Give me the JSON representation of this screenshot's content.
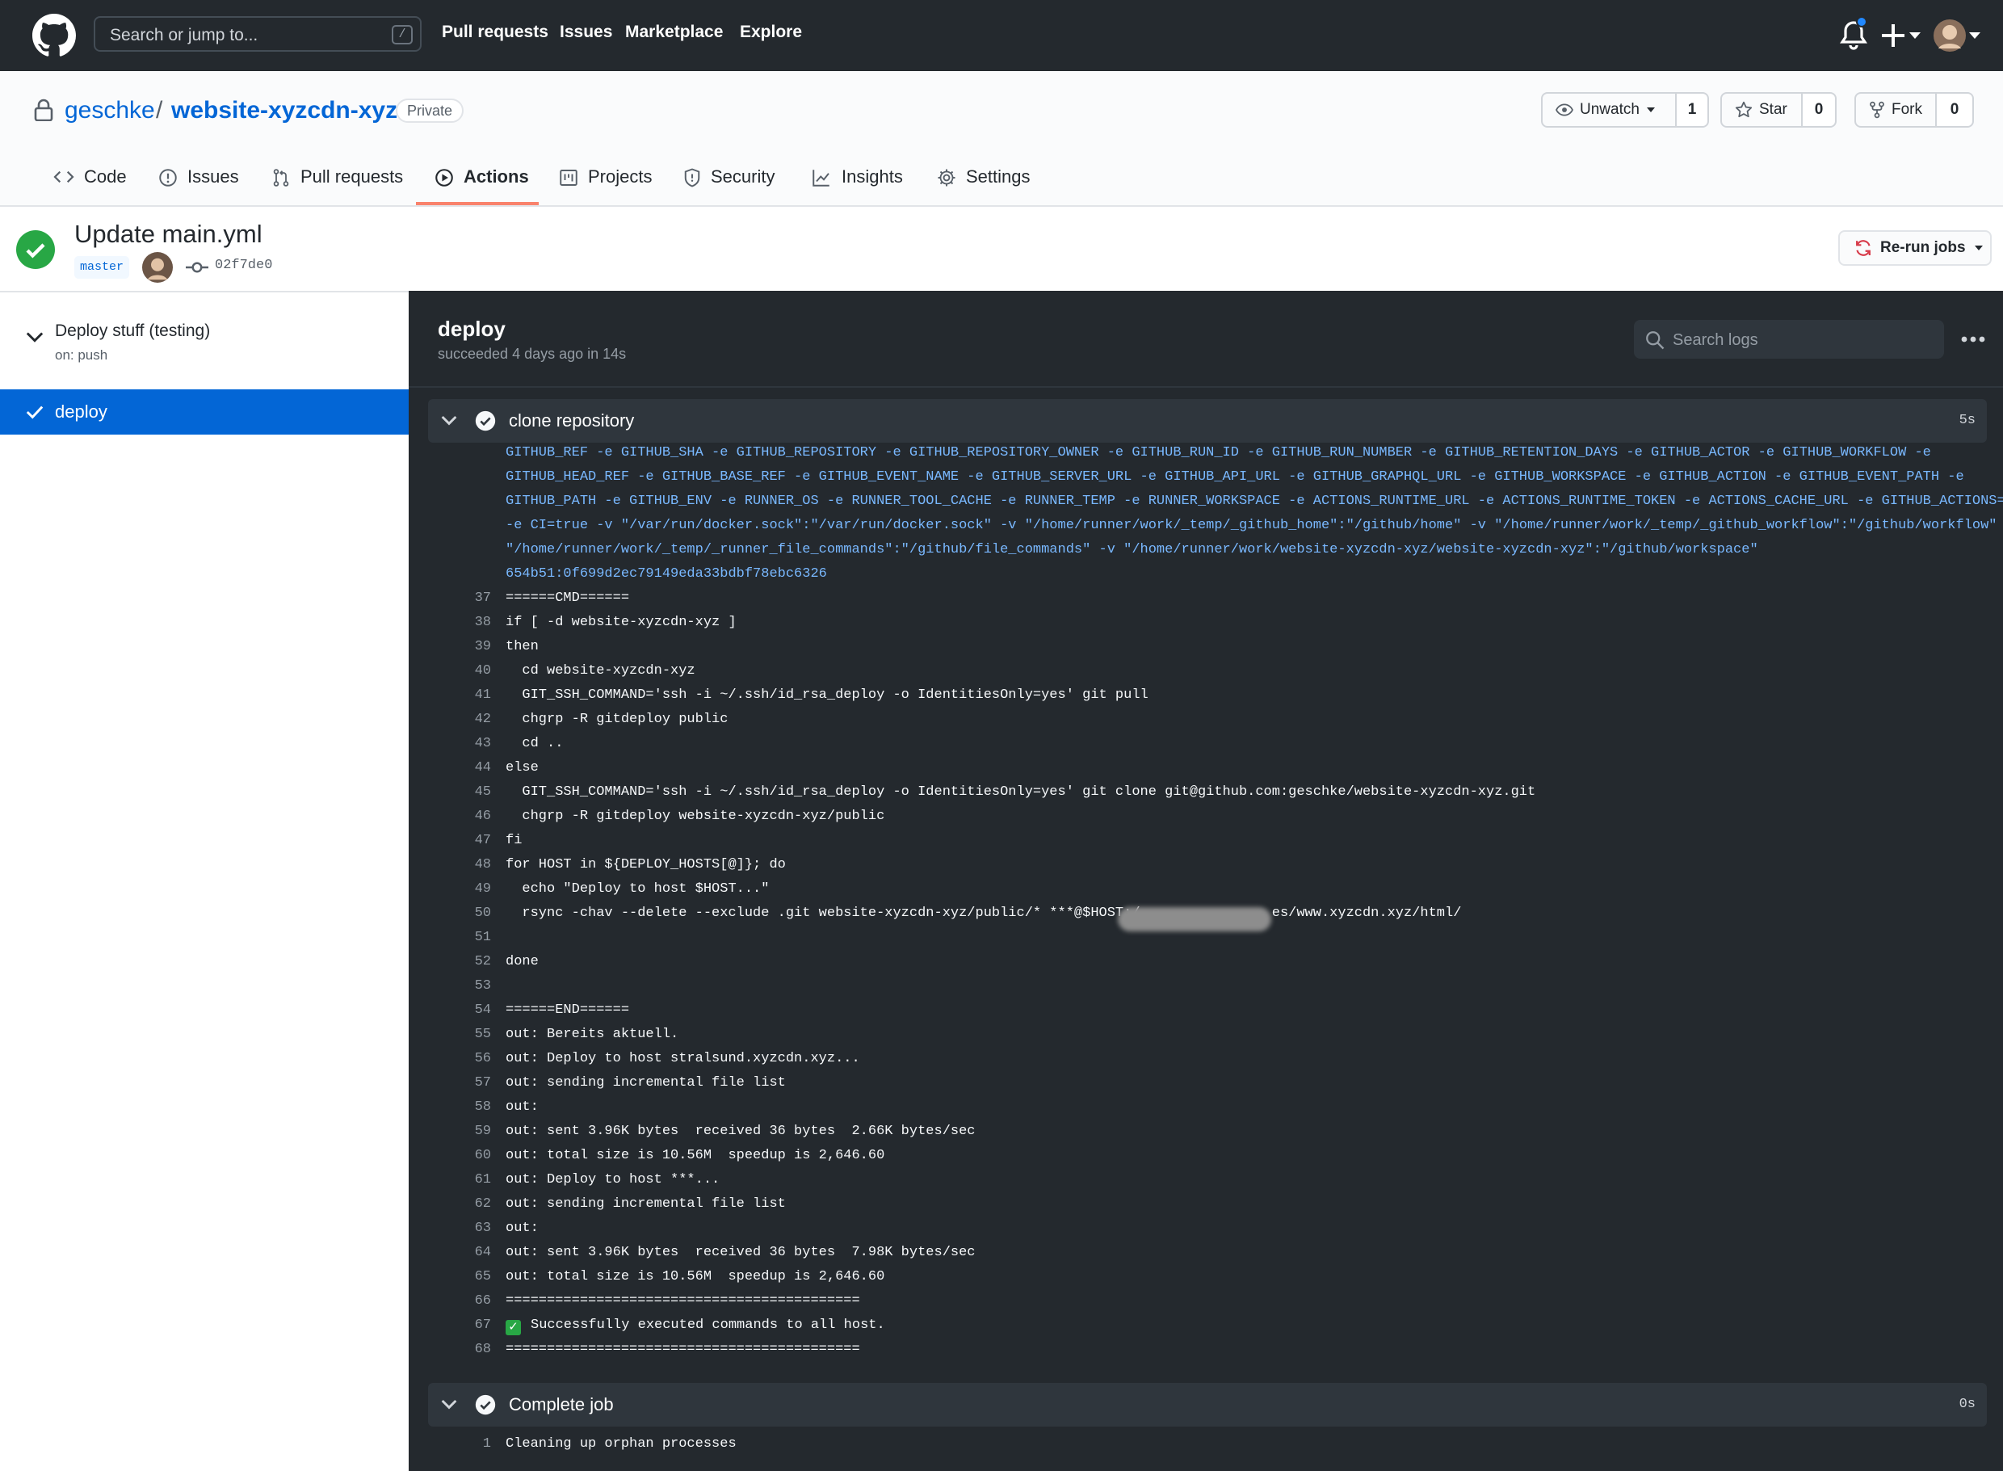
{
  "header": {
    "search_placeholder": "Search or jump to...",
    "search_shortcut": "/",
    "nav": [
      "Pull requests",
      "Issues",
      "Marketplace",
      "Explore"
    ]
  },
  "repo": {
    "owner": "geschke",
    "separator": "/",
    "name": "website-xyzcdn-xyz",
    "visibility": "Private",
    "watch_label": "Unwatch",
    "watch_count": "1",
    "star_label": "Star",
    "star_count": "0",
    "fork_label": "Fork",
    "fork_count": "0",
    "tabs": [
      "Code",
      "Issues",
      "Pull requests",
      "Actions",
      "Projects",
      "Security",
      "Insights",
      "Settings"
    ],
    "active_tab": "Actions"
  },
  "run": {
    "title": "Update main.yml",
    "branch": "master",
    "commit": "02f7de0",
    "rerun_label": "Re-run jobs"
  },
  "sidebar": {
    "workflow_name": "Deploy stuff (testing)",
    "trigger": "on: push",
    "jobs": [
      "deploy"
    ]
  },
  "log": {
    "job_title": "deploy",
    "job_status": "succeeded 4 days ago in 14s",
    "search_placeholder": "Search logs",
    "steps": [
      {
        "name": "clone repository",
        "duration": "5s"
      },
      {
        "name": "Complete job",
        "duration": "0s"
      }
    ],
    "wrapped_lines": [
      "GITHUB_REF -e GITHUB_SHA -e GITHUB_REPOSITORY -e GITHUB_REPOSITORY_OWNER -e GITHUB_RUN_ID -e GITHUB_RUN_NUMBER -e GITHUB_RETENTION_DAYS -e GITHUB_ACTOR -e GITHUB_WORKFLOW -e",
      "GITHUB_HEAD_REF -e GITHUB_BASE_REF -e GITHUB_EVENT_NAME -e GITHUB_SERVER_URL -e GITHUB_API_URL -e GITHUB_GRAPHQL_URL -e GITHUB_WORKSPACE -e GITHUB_ACTION -e GITHUB_EVENT_PATH -e",
      "GITHUB_PATH -e GITHUB_ENV -e RUNNER_OS -e RUNNER_TOOL_CACHE -e RUNNER_TEMP -e RUNNER_WORKSPACE -e ACTIONS_RUNTIME_URL -e ACTIONS_RUNTIME_TOKEN -e ACTIONS_CACHE_URL -e GITHUB_ACTIONS=true",
      "-e CI=true -v \"/var/run/docker.sock\":\"/var/run/docker.sock\" -v \"/home/runner/work/_temp/_github_home\":\"/github/home\" -v \"/home/runner/work/_temp/_github_workflow\":\"/github/workflow\" -v",
      "\"/home/runner/work/_temp/_runner_file_commands\":\"/github/file_commands\" -v \"/home/runner/work/website-xyzcdn-xyz/website-xyzcdn-xyz\":\"/github/workspace\"",
      "654b51:0f699d2ec79149eda33bdbf78ebc6326"
    ],
    "lines": [
      {
        "n": "37",
        "t": "======CMD======"
      },
      {
        "n": "38",
        "t": "if [ -d website-xyzcdn-xyz ]"
      },
      {
        "n": "39",
        "t": "then"
      },
      {
        "n": "40",
        "t": "  cd website-xyzcdn-xyz"
      },
      {
        "n": "41",
        "t": "  GIT_SSH_COMMAND='ssh -i ~/.ssh/id_rsa_deploy -o IdentitiesOnly=yes' git pull"
      },
      {
        "n": "42",
        "t": "  chgrp -R gitdeploy public"
      },
      {
        "n": "43",
        "t": "  cd .."
      },
      {
        "n": "44",
        "t": "else"
      },
      {
        "n": "45",
        "t": "  GIT_SSH_COMMAND='ssh -i ~/.ssh/id_rsa_deploy -o IdentitiesOnly=yes' git clone git@github.com:geschke/website-xyzcdn-xyz.git"
      },
      {
        "n": "46",
        "t": "  chgrp -R gitdeploy website-xyzcdn-xyz/public"
      },
      {
        "n": "47",
        "t": "fi"
      },
      {
        "n": "48",
        "t": "for HOST in ${DEPLOY_HOSTS[@]}; do"
      },
      {
        "n": "49",
        "t": "  echo \"Deploy to host $HOST...\""
      },
      {
        "n": "50",
        "t": "  rsync -chav --delete --exclude .git website-xyzcdn-xyz/public/* ***@$HOST:/                es/www.xyzcdn.xyz/html/"
      },
      {
        "n": "51",
        "t": ""
      },
      {
        "n": "52",
        "t": "done"
      },
      {
        "n": "53",
        "t": ""
      },
      {
        "n": "54",
        "t": "======END======"
      },
      {
        "n": "55",
        "t": "out: Bereits aktuell."
      },
      {
        "n": "56",
        "t": "out: Deploy to host stralsund.xyzcdn.xyz..."
      },
      {
        "n": "57",
        "t": "out: sending incremental file list"
      },
      {
        "n": "58",
        "t": "out:"
      },
      {
        "n": "59",
        "t": "out: sent 3.96K bytes  received 36 bytes  2.66K bytes/sec"
      },
      {
        "n": "60",
        "t": "out: total size is 10.56M  speedup is 2,646.60"
      },
      {
        "n": "61",
        "t": "out: Deploy to host ***..."
      },
      {
        "n": "62",
        "t": "out: sending incremental file list"
      },
      {
        "n": "63",
        "t": "out:"
      },
      {
        "n": "64",
        "t": "out: sent 3.96K bytes  received 36 bytes  7.98K bytes/sec"
      },
      {
        "n": "65",
        "t": "out: total size is 10.56M  speedup is 2,646.60"
      },
      {
        "n": "66",
        "t": "==========================================="
      },
      {
        "n": "67",
        "t": "Successfully executed commands to all host."
      },
      {
        "n": "68",
        "t": "==========================================="
      }
    ],
    "complete_lines": [
      {
        "n": "1",
        "t": "Cleaning up orphan processes"
      }
    ]
  },
  "colors": {
    "header_bg": "#24292e",
    "link": "#0366d6",
    "success": "#28a745",
    "active_tab_underline": "#f9826c",
    "log_bg": "#24292e",
    "log_env_text": "#79b8ff"
  },
  "icons": [
    "github-logo-icon",
    "lock-icon",
    "eye-icon",
    "star-icon",
    "fork-icon",
    "code-icon",
    "issue-icon",
    "pull-request-icon",
    "play-icon",
    "project-icon",
    "shield-icon",
    "graph-icon",
    "gear-icon",
    "bell-icon",
    "plus-icon",
    "check-icon",
    "commit-icon",
    "sync-icon",
    "search-icon",
    "kebab-icon",
    "chevron-down-icon"
  ]
}
